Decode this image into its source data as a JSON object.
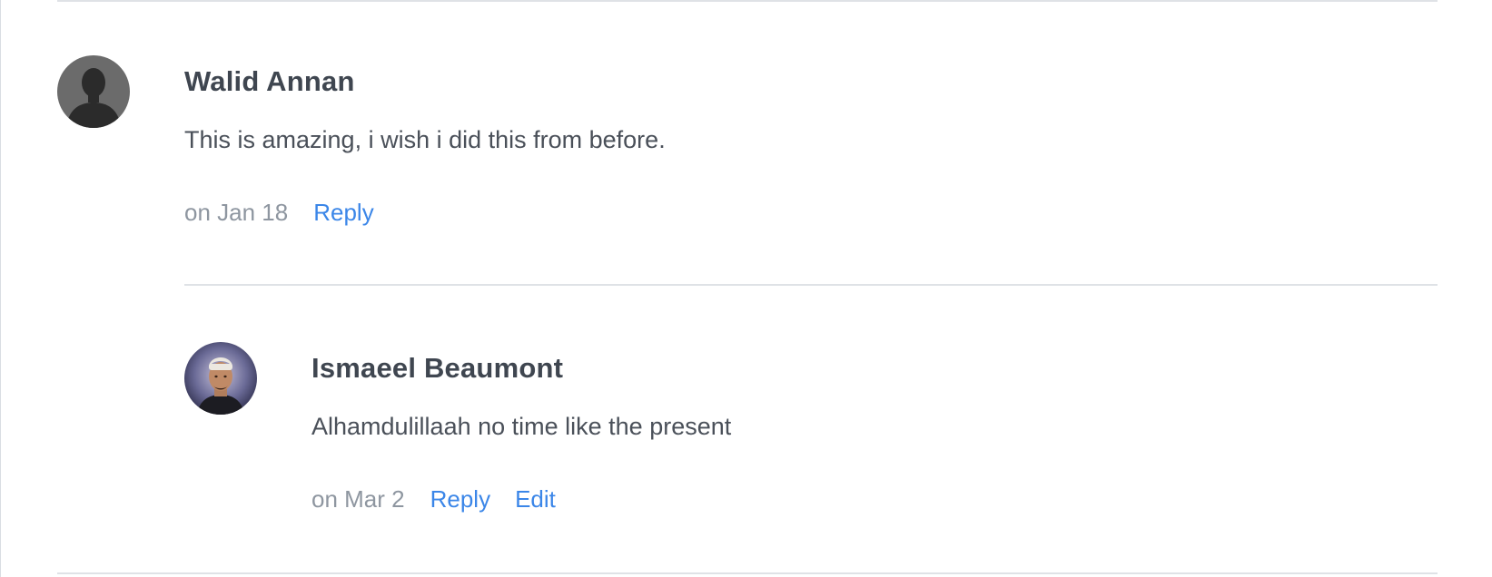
{
  "comments": [
    {
      "author": "Walid Annan",
      "avatar": "default-silhouette-avatar",
      "text": "This is amazing, i wish i did this from before.",
      "date": "on Jan 18",
      "actions": {
        "reply": "Reply"
      }
    },
    {
      "author": "Ismaeel Beaumont",
      "avatar": "user-photo-avatar",
      "text": "Alhamdulillaah no time like the present",
      "date": "on Mar 2",
      "actions": {
        "reply": "Reply",
        "edit": "Edit"
      }
    }
  ],
  "colors": {
    "link": "#3b86e8",
    "author": "#3f4650",
    "date": "#8e96a0",
    "divider": "#dfe2e6"
  }
}
